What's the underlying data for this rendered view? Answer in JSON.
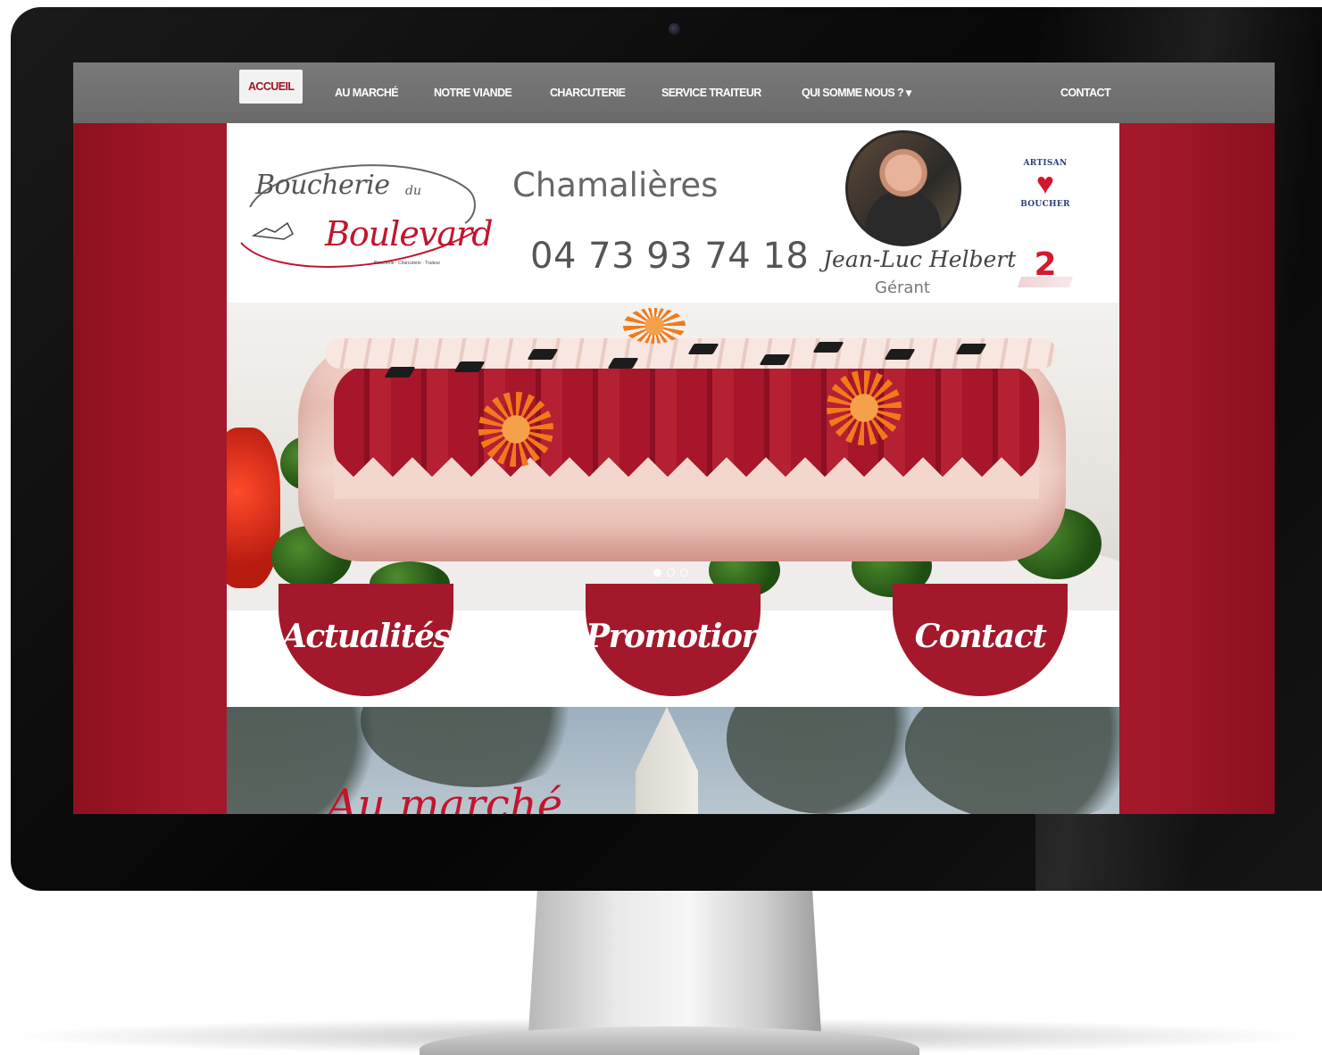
{
  "nav": {
    "items": [
      {
        "label": "ACCUEIL",
        "active": true
      },
      {
        "label": "AU MARCHÉ",
        "active": false
      },
      {
        "label": "NOTRE VIANDE",
        "active": false
      },
      {
        "label": "CHARCUTERIE",
        "active": false
      },
      {
        "label": "SERVICE TRAITEUR",
        "active": false
      },
      {
        "label": "QUI SOMME NOUS ? ▾",
        "active": false
      }
    ],
    "contact_label": "CONTACT"
  },
  "header": {
    "logo": {
      "line1": "Boucherie",
      "du": "du",
      "line2": "Boulevard",
      "tagline": "Boucherie · Charcuterie · Traiteur"
    },
    "city": "Chamalières",
    "phone": "04 73 93 74 18",
    "manager_signature": "Jean-Luc Helbert",
    "manager_title": "Gérant",
    "badge_artisan_top": "ARTISAN",
    "badge_artisan_bottom": "BOUCHER",
    "badge_second": "2"
  },
  "hero": {
    "slides_total": 3,
    "active_slide": 1
  },
  "buttons": [
    {
      "label": "Actualités"
    },
    {
      "label": "Promotions"
    },
    {
      "label": "Contact"
    }
  ],
  "market": {
    "title": "Au marché"
  },
  "colors": {
    "brand_red": "#a3182a",
    "nav_gray": "#707070"
  }
}
